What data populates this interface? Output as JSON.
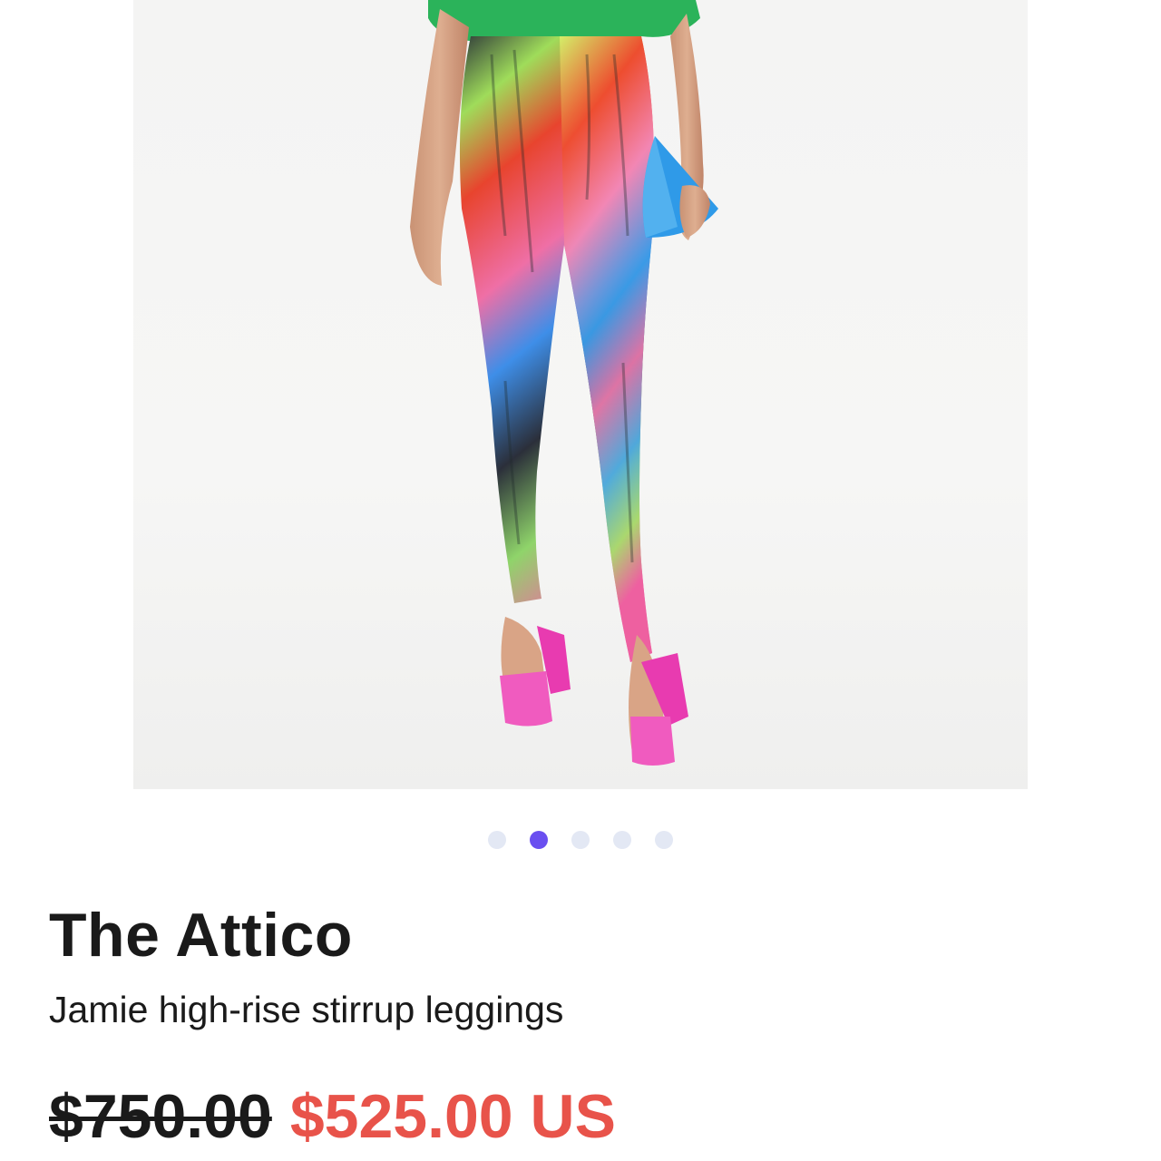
{
  "product": {
    "image_alt": "Model wearing multicolor stirrup leggings with pink heels and blue triangle clutch",
    "brand": "The Attico",
    "name": "Jamie high-rise stirrup leggings",
    "price_original": "$750.00",
    "price_sale": "$525.00 US"
  },
  "carousel": {
    "count": 5,
    "active_index": 1
  },
  "colors": {
    "accent_dot": "#6a4ff0",
    "inactive_dot": "#e3e8f4",
    "sale_price": "#e8534a",
    "text": "#1a1a1a"
  }
}
